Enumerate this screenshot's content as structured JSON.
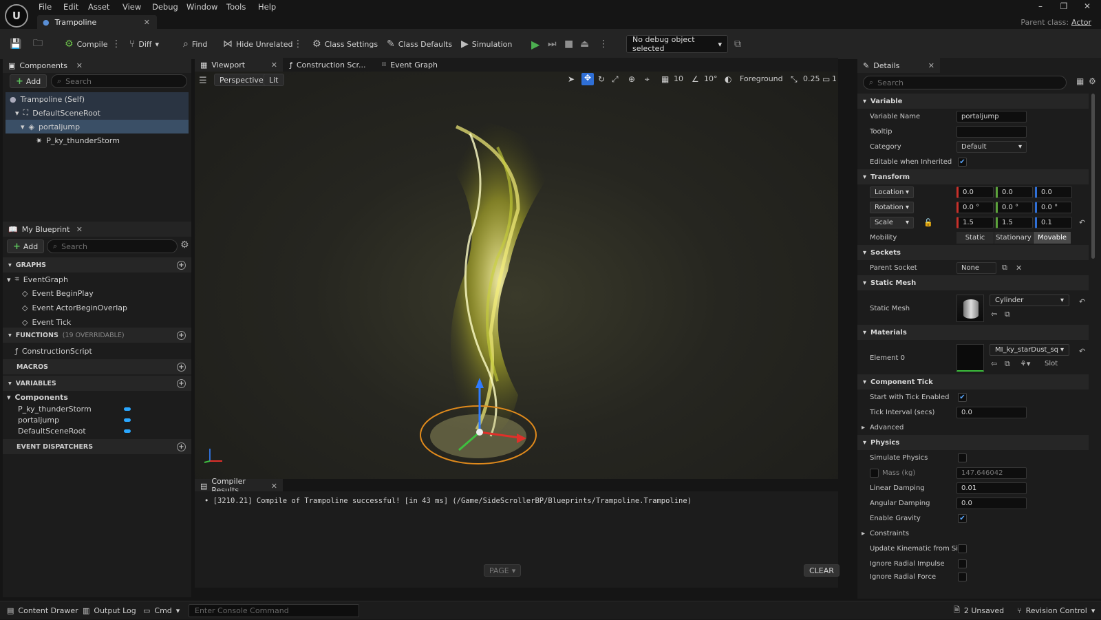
{
  "app": {
    "menu": [
      "File",
      "Edit",
      "Asset",
      "View",
      "Debug",
      "Window",
      "Tools",
      "Help"
    ],
    "doc_tab": "Trampoline",
    "parent_class_label": "Parent class:",
    "parent_class_value": "Actor",
    "window_controls": {
      "minimize": "–",
      "restore": "❐",
      "close": "✕"
    }
  },
  "toolbar": {
    "compile": "Compile",
    "diff": "Diff",
    "find": "Find",
    "hide_unrelated": "Hide Unrelated",
    "class_settings": "Class Settings",
    "class_defaults": "Class Defaults",
    "simulation": "Simulation",
    "debug_object": "No debug object selected"
  },
  "components_panel": {
    "title": "Components",
    "add": "Add",
    "search_placeholder": "Search",
    "tree": [
      {
        "label": "Trampoline (Self)",
        "indent": 0,
        "selected": false
      },
      {
        "label": "DefaultSceneRoot",
        "indent": 1,
        "selected": false
      },
      {
        "label": "portaljump",
        "indent": 2,
        "selected": true
      },
      {
        "label": "P_ky_thunderStorm",
        "indent": 3,
        "selected": false
      }
    ]
  },
  "my_blueprint": {
    "title": "My Blueprint",
    "add": "Add",
    "search_placeholder": "Search",
    "graphs_label": "GRAPHS",
    "event_graph": "EventGraph",
    "events": [
      "Event BeginPlay",
      "Event ActorBeginOverlap",
      "Event Tick"
    ],
    "functions_label": "FUNCTIONS",
    "functions_note": "(19 OVERRIDABLE)",
    "construction_script": "ConstructionScript",
    "macros_label": "MACROS",
    "variables_label": "VARIABLES",
    "components_group": "Components",
    "variables": [
      "P_ky_thunderStorm",
      "portaljump",
      "DefaultSceneRoot"
    ],
    "event_dispatchers_label": "EVENT DISPATCHERS"
  },
  "editor_tabs": {
    "viewport": "Viewport",
    "construction": "Construction Scr...",
    "event_graph": "Event Graph"
  },
  "viewport": {
    "perspective": "Perspective",
    "lit": "Lit",
    "grid_snap": "10",
    "angle_snap": "10°",
    "layer": "Foreground",
    "scale_snap": "0.25",
    "camera_speed": "1"
  },
  "compiler": {
    "title": "Compiler Results",
    "message": "[3210.21] Compile of Trampoline successful! [in 43 ms] (/Game/SideScrollerBP/Blueprints/Trampoline.Trampoline)",
    "page": "PAGE",
    "clear": "CLEAR"
  },
  "details": {
    "title": "Details",
    "search_placeholder": "Search",
    "variable_section": "Variable",
    "variable_name_label": "Variable Name",
    "variable_name": "portaljump",
    "tooltip_label": "Tooltip",
    "tooltip_value": "",
    "category_label": "Category",
    "category_value": "Default",
    "editable_label": "Editable when Inherited",
    "transform_section": "Transform",
    "location_label": "Location",
    "location": [
      "0.0",
      "0.0",
      "0.0"
    ],
    "rotation_label": "Rotation",
    "rotation": [
      "0.0 °",
      "0.0 °",
      "0.0 °"
    ],
    "scale_label": "Scale",
    "scale": [
      "1.5",
      "1.5",
      "0.1"
    ],
    "mobility_label": "Mobility",
    "mobility_options": [
      "Static",
      "Stationary",
      "Movable"
    ],
    "sockets_section": "Sockets",
    "parent_socket_label": "Parent Socket",
    "parent_socket_value": "None",
    "static_mesh_section": "Static Mesh",
    "static_mesh_label": "Static Mesh",
    "static_mesh_value": "Cylinder",
    "materials_section": "Materials",
    "element0_label": "Element 0",
    "element0_value": "MI_ky_starDust_sq",
    "slot_label": "Slot",
    "component_tick_section": "Component Tick",
    "start_tick_label": "Start with Tick Enabled",
    "tick_interval_label": "Tick Interval (secs)",
    "tick_interval_value": "0.0",
    "advanced_label": "Advanced",
    "physics_section": "Physics",
    "simulate_label": "Simulate Physics",
    "mass_label": "Mass (kg)",
    "mass_value": "147.646042",
    "linear_damping_label": "Linear Damping",
    "linear_damping_value": "0.01",
    "angular_damping_label": "Angular Damping",
    "angular_damping_value": "0.0",
    "gravity_label": "Enable Gravity",
    "constraints_label": "Constraints",
    "kinematic_label": "Update Kinematic from Si...",
    "radial_impulse_label": "Ignore Radial Impulse",
    "radial_force_label": "Ignore Radial Force"
  },
  "statusbar": {
    "content_drawer": "Content Drawer",
    "output_log": "Output Log",
    "cmd": "Cmd",
    "console_placeholder": "Enter Console Command",
    "unsaved": "2 Unsaved",
    "revision_control": "Revision Control"
  },
  "colors": {
    "accent_blue": "#2aa7ff",
    "selection": "#3a4f66",
    "play_green": "#4caf50"
  }
}
